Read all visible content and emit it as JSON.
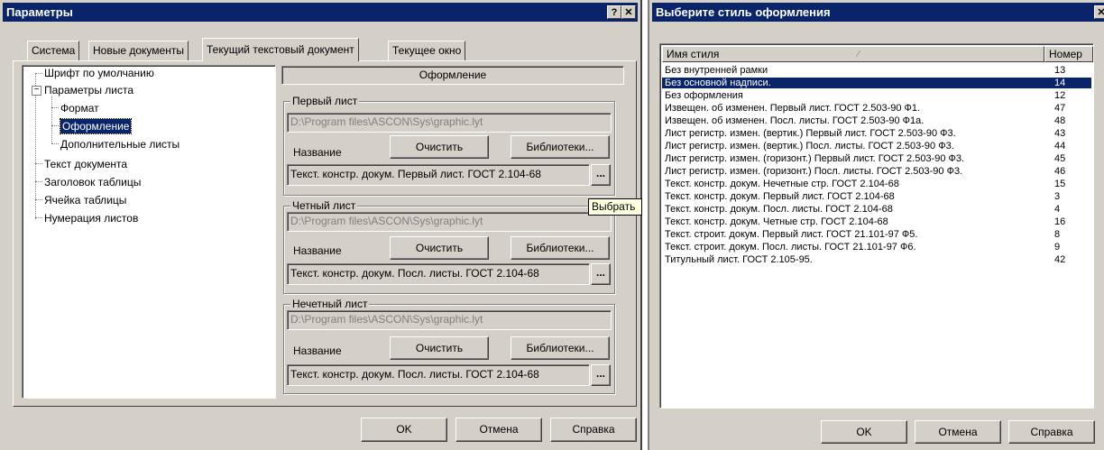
{
  "dialog1": {
    "title": "Параметры",
    "help_btn": "?",
    "close_btn": "✕",
    "tabs": [
      "Система",
      "Новые документы",
      "Текущий текстовый документ",
      "Текущее окно"
    ],
    "tree": {
      "items": [
        {
          "label": "Шрифт по умолчанию"
        },
        {
          "label": "Параметры листа",
          "expander": "−"
        },
        {
          "label": "Формат"
        },
        {
          "label": "Оформление"
        },
        {
          "label": "Дополнительные листы"
        },
        {
          "label": "Текст документа"
        },
        {
          "label": "Заголовок таблицы"
        },
        {
          "label": "Ячейка таблицы"
        },
        {
          "label": "Нумерация листов"
        }
      ]
    },
    "panel_header": "Оформление",
    "groups": [
      {
        "label": "Первый лист",
        "path": "D:\\Program files\\ASCON\\Sys\\graphic.lyt",
        "name_label": "Название",
        "clear_btn": "Очистить",
        "libs_btn": "Библиотеки...",
        "value": "Текст. констр. докум. Первый лист. ГОСТ 2.104-68",
        "browse_btn": "..."
      },
      {
        "label": "Четный лист",
        "path": "D:\\Program files\\ASCON\\Sys\\graphic.lyt",
        "name_label": "Название",
        "clear_btn": "Очистить",
        "libs_btn": "Библиотеки...",
        "value": "Текст. констр. докум. Посл. листы. ГОСТ 2.104-68",
        "browse_btn": "..."
      },
      {
        "label": "Нечетный лист",
        "path": "D:\\Program files\\ASCON\\Sys\\graphic.lyt",
        "name_label": "Название",
        "clear_btn": "Очистить",
        "libs_btn": "Библиотеки...",
        "value": "Текст. констр. докум. Посл. листы. ГОСТ 2.104-68",
        "browse_btn": "..."
      }
    ],
    "tooltip": "Выбрать",
    "ok": "OK",
    "cancel": "Отмена",
    "help": "Справка"
  },
  "dialog2": {
    "title": "Выберите стиль оформления",
    "close_btn": "✕",
    "col_name": "Имя стиля",
    "col_num": "Номер",
    "sort_mark": "⁄",
    "rows": [
      {
        "name": "Без внутренней рамки",
        "num": "13"
      },
      {
        "name": "Без основной надписи.",
        "num": "14",
        "selected": true
      },
      {
        "name": "Без оформления",
        "num": "12"
      },
      {
        "name": "Извещен. об изменен. Первый лист. ГОСТ 2.503-90 Ф1.",
        "num": "47"
      },
      {
        "name": "Извещен. об изменен. Посл. листы. ГОСТ 2.503-90 Ф1а.",
        "num": "48"
      },
      {
        "name": "Лист регистр. измен. (вертик.) Первый лист. ГОСТ 2.503-90 Ф3.",
        "num": "43"
      },
      {
        "name": "Лист регистр. измен. (вертик.) Посл. листы. ГОСТ 2.503-90 Ф3.",
        "num": "44"
      },
      {
        "name": "Лист регистр. измен. (горизонт.) Первый лист. ГОСТ 2.503-90 Ф3.",
        "num": "45"
      },
      {
        "name": "Лист регистр. измен. (горизонт.) Посл. листы. ГОСТ 2.503-90 Ф3.",
        "num": "46"
      },
      {
        "name": "Текст. констр. докум. Нечетные стр. ГОСТ 2.104-68",
        "num": "15"
      },
      {
        "name": "Текст. констр. докум. Первый лист. ГОСТ 2.104-68",
        "num": "3"
      },
      {
        "name": "Текст. констр. докум. Посл. листы. ГОСТ 2.104-68",
        "num": "4"
      },
      {
        "name": "Текст. констр. докум. Четные стр. ГОСТ 2.104-68",
        "num": "16"
      },
      {
        "name": "Текст. строит. докум. Первый лист. ГОСТ 21.101-97 Ф5.",
        "num": "8"
      },
      {
        "name": "Текст. строит. докум. Посл. листы. ГОСТ 21.101-97 Ф6.",
        "num": "9"
      },
      {
        "name": "Титульный лист. ГОСТ 2.105-95.",
        "num": "42"
      }
    ],
    "ok": "OK",
    "cancel": "Отмена",
    "help": "Справка"
  },
  "colors": {
    "face": "#d4d0c8",
    "title_bar": "#0a246a",
    "selection": "#0a246a",
    "tooltip": "#ffffe1"
  }
}
